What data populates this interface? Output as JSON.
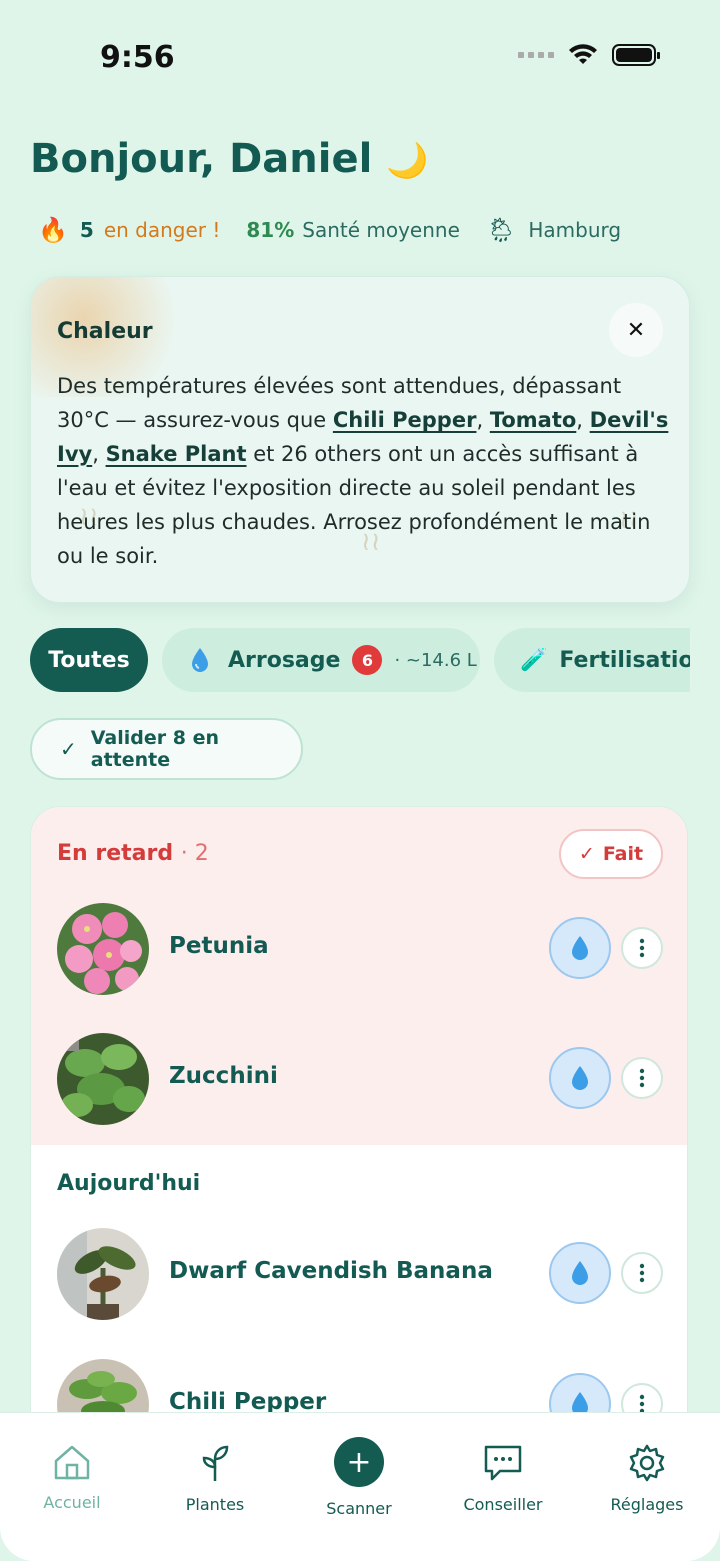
{
  "status_bar": {
    "time": "9:56"
  },
  "header": {
    "greeting": "Bonjour, Daniel",
    "greeting_emoji": "🌙"
  },
  "stats": {
    "danger_count": "5",
    "danger_label": "en danger !",
    "health_pct": "81%",
    "health_label": "Santé moyenne",
    "city": "Hamburg"
  },
  "alert": {
    "title": "Chaleur",
    "close": "✕",
    "text_prefix": "Des températures élevées sont attendues, dépassant 30°C — assurez-vous que ",
    "plant1": "Chili Pepper",
    "plant2": "Tomato",
    "plant3": "Devil's Ivy",
    "plant4": "Snake Plant",
    "text_suffix": " et 26 others ont un accès suffisant à l'eau et évitez l'exposition directe au soleil pendant les heures les plus chaudes. Arrosez profondément le matin ou le soir."
  },
  "filters": {
    "all": "Toutes",
    "watering": "Arrosage",
    "watering_badge": "6",
    "watering_volume": "· ~14.6 L",
    "fertilization": "Fertilisation"
  },
  "validate_label": "Valider 8 en attente",
  "sections": {
    "late_title": "En retard",
    "late_count": "· 2",
    "done_label": "Fait",
    "today_title": "Aujourd'hui"
  },
  "plants": [
    {
      "name": "Petunia"
    },
    {
      "name": "Zucchini"
    },
    {
      "name": "Dwarf Cavendish Banana"
    },
    {
      "name": "Chili Pepper"
    }
  ],
  "nav": {
    "home": "Accueil",
    "plants": "Plantes",
    "scan": "Scanner",
    "advisor": "Conseiller",
    "settings": "Réglages"
  },
  "colors": {
    "primary": "#145b52",
    "background": "#dff5ea",
    "danger": "#d43b3b",
    "water": "#3d9ee8"
  }
}
